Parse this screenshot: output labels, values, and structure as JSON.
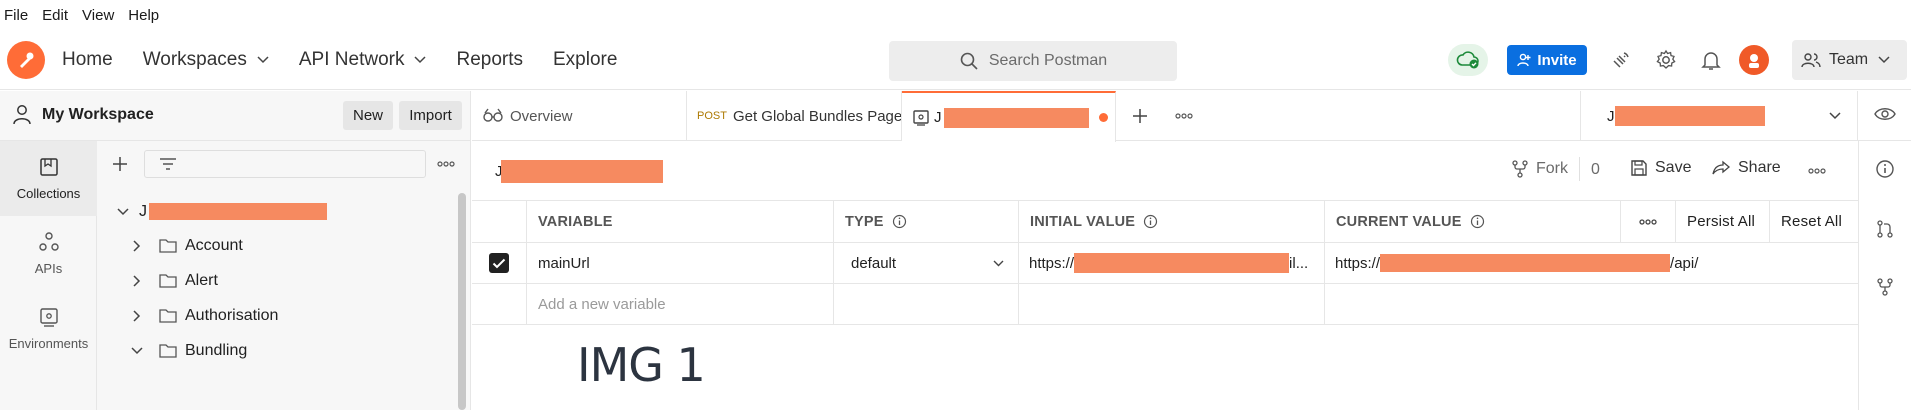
{
  "menubar": {
    "items": [
      "File",
      "Edit",
      "View",
      "Help"
    ]
  },
  "header": {
    "nav": [
      {
        "label": "Home",
        "dropdown": false
      },
      {
        "label": "Workspaces",
        "dropdown": true
      },
      {
        "label": "API Network",
        "dropdown": true
      },
      {
        "label": "Reports",
        "dropdown": false
      },
      {
        "label": "Explore",
        "dropdown": false
      }
    ],
    "search_placeholder": "Search Postman",
    "invite_label": "Invite",
    "team_label": "Team"
  },
  "workspace": {
    "title": "My Workspace",
    "new_label": "New",
    "import_label": "Import"
  },
  "rail": [
    {
      "label": "Collections",
      "icon": "collections-icon",
      "active": true
    },
    {
      "label": "APIs",
      "icon": "apis-icon",
      "active": false
    },
    {
      "label": "Environments",
      "icon": "environments-icon",
      "active": false
    }
  ],
  "tree": {
    "root_prefix": "J",
    "folders": [
      {
        "label": "Account",
        "expanded": false
      },
      {
        "label": "Alert",
        "expanded": false
      },
      {
        "label": "Authorisation",
        "expanded": false
      },
      {
        "label": "Bundling",
        "expanded": true
      }
    ]
  },
  "tabs": [
    {
      "label": "Overview",
      "method": ""
    },
    {
      "label": "Get Global Bundles Page",
      "method": "POST"
    },
    {
      "label": "J",
      "method": "",
      "active": true,
      "unsaved": true
    }
  ],
  "environment": {
    "selected_prefix": "J",
    "title_prefix": "J"
  },
  "editor_actions": {
    "fork_label": "Fork",
    "fork_count": "0",
    "save_label": "Save",
    "share_label": "Share"
  },
  "table": {
    "headers": {
      "variable": "VARIABLE",
      "type": "TYPE",
      "initial": "INITIAL VALUE",
      "current": "CURRENT VALUE",
      "persist_all": "Persist All",
      "reset_all": "Reset All"
    },
    "rows": [
      {
        "checked": true,
        "variable": "mainUrl",
        "type": "default",
        "initial_prefix": "https://",
        "initial_suffix": "il...",
        "current_prefix": "https://",
        "current_suffix": "/api/"
      }
    ],
    "new_placeholder": "Add a new variable"
  },
  "caption": "IMG 1",
  "colors": {
    "brand": "#ff6c37",
    "invite": "#0a6fe0",
    "redaction": "#f68a60"
  }
}
